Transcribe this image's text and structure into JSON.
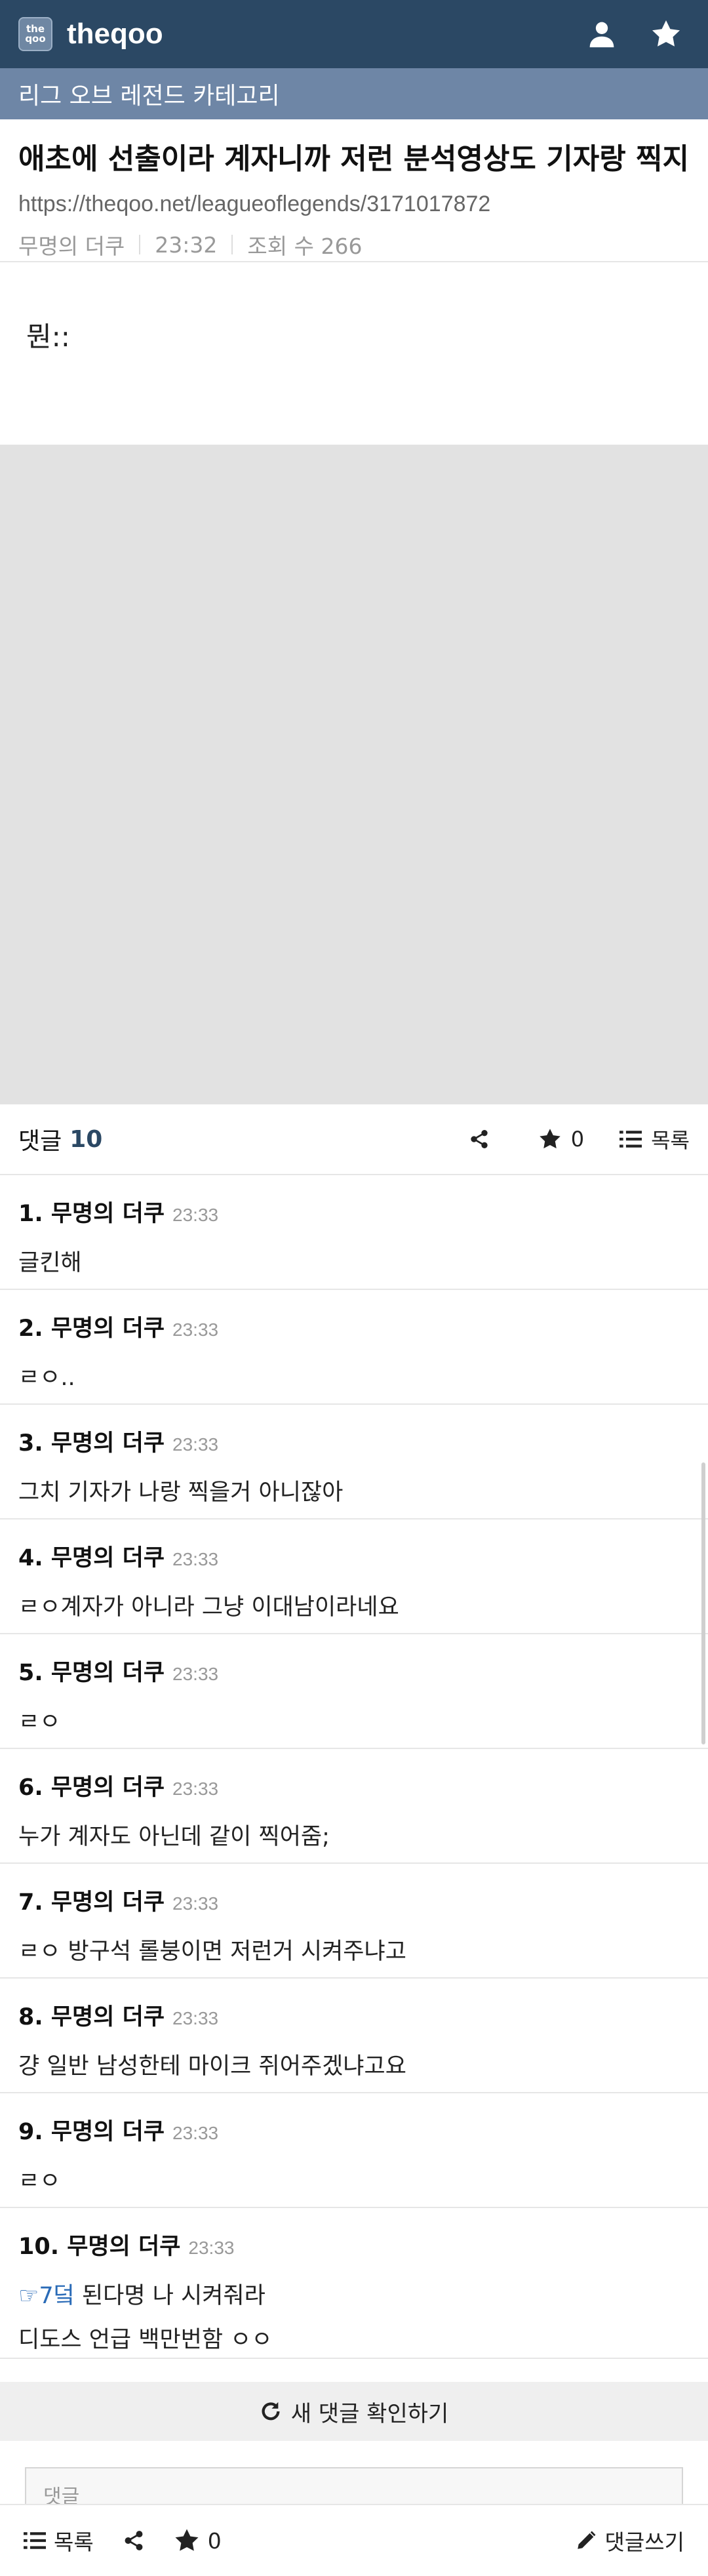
{
  "header": {
    "logo_text": "the\nqoo",
    "site_name": "theqoo",
    "icons": [
      "user-icon",
      "star-icon"
    ]
  },
  "category": "리그 오브 레전드 카테고리",
  "post": {
    "title": "애초에 선출이라 계자니까 저런 분석영상도 기자랑 찍지..",
    "url": "https://theqoo.net/leagueoflegends/3171017872",
    "author": "무명의 더쿠",
    "time": "23:32",
    "views": "조회 수 266",
    "body": "뭔::"
  },
  "comments_header": {
    "label": "댓글",
    "count": "10",
    "star_count": "0",
    "list_label": "목록"
  },
  "comments": [
    {
      "num": "1.",
      "author": "무명의 더쿠",
      "time": "23:33",
      "text": "글킨해"
    },
    {
      "num": "2.",
      "author": "무명의 더쿠",
      "time": "23:33",
      "text": "ㄹㅇ.."
    },
    {
      "num": "3.",
      "author": "무명의 더쿠",
      "time": "23:33",
      "text": "그치 기자가 나랑 찍을거 아니잖아"
    },
    {
      "num": "4.",
      "author": "무명의 더쿠",
      "time": "23:33",
      "text": "ㄹㅇ계자가 아니라 그냥 이대남이라네요"
    },
    {
      "num": "5.",
      "author": "무명의 더쿠",
      "time": "23:33",
      "text": "ㄹㅇ"
    },
    {
      "num": "6.",
      "author": "무명의 더쿠",
      "time": "23:33",
      "text": "누가 계자도 아닌데 같이 찍어줌;"
    },
    {
      "num": "7.",
      "author": "무명의 더쿠",
      "time": "23:33",
      "text": "ㄹㅇ 방구석 롤붕이면 저런거 시켜주냐고"
    },
    {
      "num": "8.",
      "author": "무명의 더쿠",
      "time": "23:33",
      "text": "걍 일반 남성한테 마이크 쥐어주겠냐고요"
    },
    {
      "num": "9.",
      "author": "무명의 더쿠",
      "time": "23:33",
      "text": "ㄹㅇ"
    },
    {
      "num": "10.",
      "author": "무명의 더쿠",
      "time": "23:33",
      "link": "☞7덬",
      "text": " 된다명 나 시켜줘라",
      "text2": "디도스 언급 백만번함 ㅇㅇ"
    }
  ],
  "refresh_label": "새 댓글 확인하기",
  "write_placeholder": "댓글",
  "bottom": {
    "list_label": "목록",
    "star_count": "0",
    "write_label": "댓글쓰기"
  },
  "colors": {
    "header_bg": "#2b4864",
    "category_bg": "#6e86a6",
    "accent": "#2b4864",
    "link": "#2a6bb7"
  }
}
